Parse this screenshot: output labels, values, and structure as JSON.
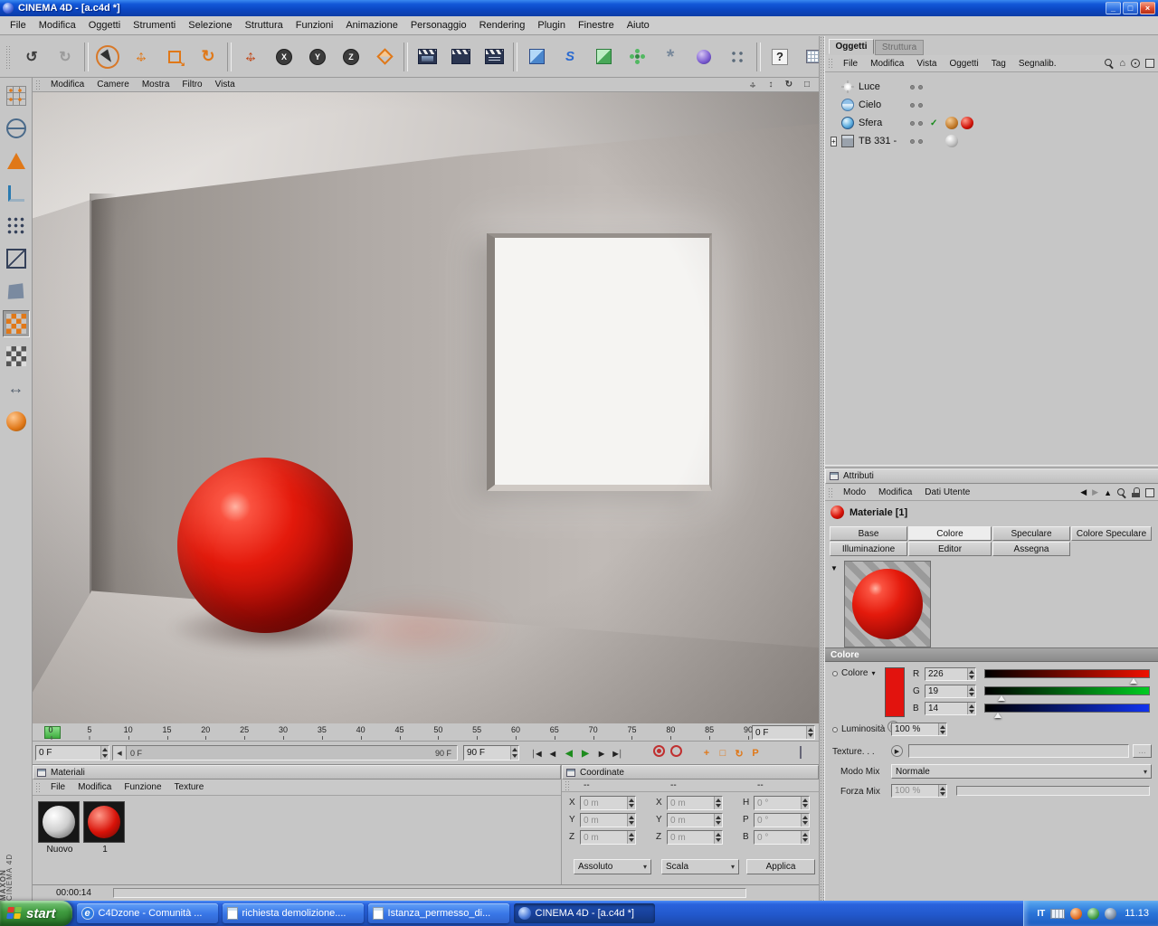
{
  "window": {
    "title": "CINEMA 4D - [a.c4d *]",
    "menus": [
      "File",
      "Modifica",
      "Oggetti",
      "Strumenti",
      "Selezione",
      "Struttura",
      "Funzioni",
      "Animazione",
      "Personaggio",
      "Rendering",
      "Plugin",
      "Finestre",
      "Aiuto"
    ]
  },
  "viewport": {
    "menus": [
      "Modifica",
      "Camere",
      "Mostra",
      "Filtro",
      "Vista"
    ]
  },
  "timeline": {
    "ticks": [
      "0",
      "5",
      "10",
      "15",
      "20",
      "25",
      "30",
      "35",
      "40",
      "45",
      "50",
      "55",
      "60",
      "65",
      "70",
      "75",
      "80",
      "85",
      "90"
    ],
    "frame_field": "0 F",
    "current": "0 F",
    "range_start": "0 F",
    "range_end": "90 F",
    "end_field": "90 F"
  },
  "materials": {
    "title": "Materiali",
    "menus": [
      "File",
      "Modifica",
      "Funzione",
      "Texture"
    ],
    "items": [
      {
        "label": "Nuovo"
      },
      {
        "label": "1"
      }
    ]
  },
  "coordinates": {
    "title": "Coordinate",
    "cols": [
      "--",
      "--",
      "--"
    ],
    "position": {
      "rows": [
        {
          "l": "X",
          "v": "0 m"
        },
        {
          "l": "Y",
          "v": "0 m"
        },
        {
          "l": "Z",
          "v": "0 m"
        }
      ]
    },
    "size": {
      "rows": [
        {
          "l": "X",
          "v": "0 m"
        },
        {
          "l": "Y",
          "v": "0 m"
        },
        {
          "l": "Z",
          "v": "0 m"
        }
      ]
    },
    "rotation": {
      "rows": [
        {
          "l": "H",
          "v": "0 °"
        },
        {
          "l": "P",
          "v": "0 °"
        },
        {
          "l": "B",
          "v": "0 °"
        }
      ]
    },
    "mode": "Assoluto",
    "scale_mode": "Scala",
    "apply": "Applica"
  },
  "object_manager": {
    "tabs": [
      "Oggetti",
      "Struttura"
    ],
    "active_tab": "Oggetti",
    "menus": [
      "File",
      "Modifica",
      "Vista",
      "Oggetti",
      "Tag",
      "Segnalib."
    ],
    "objects": [
      {
        "name": "Luce"
      },
      {
        "name": "Cielo"
      },
      {
        "name": "Sfera"
      },
      {
        "name": "TB 331 -"
      }
    ]
  },
  "attributes": {
    "title": "Attributi",
    "menus": [
      "Modo",
      "Modifica",
      "Dati Utente"
    ],
    "material_name": "Materiale [1]",
    "tabs1": [
      "Base",
      "Colore",
      "Speculare",
      "Colore Speculare"
    ],
    "tabs2": [
      "Illuminazione",
      "Editor",
      "Assegna"
    ],
    "active_tab": "Colore",
    "section": "Colore",
    "color_label": "Colore",
    "r_label": "R",
    "r_value": "226",
    "g_label": "G",
    "g_value": "19",
    "b_label": "B",
    "b_value": "14",
    "swatch_color": "#e2130e",
    "brightness_label": "Luminosità",
    "brightness_value": "100 %",
    "texture_label": "Texture. . .",
    "texture_browse": "...",
    "mix_mode_label": "Modo Mix",
    "mix_mode_value": "Normale",
    "mix_strength_label": "Forza Mix",
    "mix_strength_value": "100 %"
  },
  "statusbar": {
    "time": "00:00:14"
  },
  "branding": {
    "line1": "MAXON",
    "line2": "CINEMA 4D"
  },
  "taskbar": {
    "start_label": "start",
    "buttons": [
      {
        "label": "C4Dzone - Comunità ..."
      },
      {
        "label": "richiesta demolizione...."
      },
      {
        "label": "Istanza_permesso_di..."
      },
      {
        "label": "CINEMA 4D - [a.c4d *]"
      }
    ],
    "tray": {
      "lang": "IT",
      "time": "11.13"
    }
  },
  "icons": {
    "minimize": "_",
    "maximize": "□",
    "close": "×",
    "undo": "↺",
    "redo": "↻",
    "lock-x": "X",
    "lock-y": "Y",
    "lock-z": "Z",
    "help": "?",
    "spline": "S",
    "particle": "*",
    "arrow-h": "↔",
    "arrow-v": "↕",
    "arrow-diag": "↘",
    "rotate": "↻",
    "t-start": "│◀",
    "t-prevkey": "◀",
    "t-playrev": "◀",
    "t-play": "▶",
    "t-nextkey": "▶",
    "t-end": "▶│",
    "key-pos": "+",
    "key-scale": "□",
    "key-rot": "↻",
    "key-param": "P",
    "dd-arrow": "▾",
    "expand-down": "▼",
    "expand-right": "▶",
    "plus": "+",
    "back": "◀",
    "forward": "▶",
    "up": "▲",
    "home": "⌂",
    "check": "✓",
    "view-toggle": "□",
    "ie": "e"
  }
}
